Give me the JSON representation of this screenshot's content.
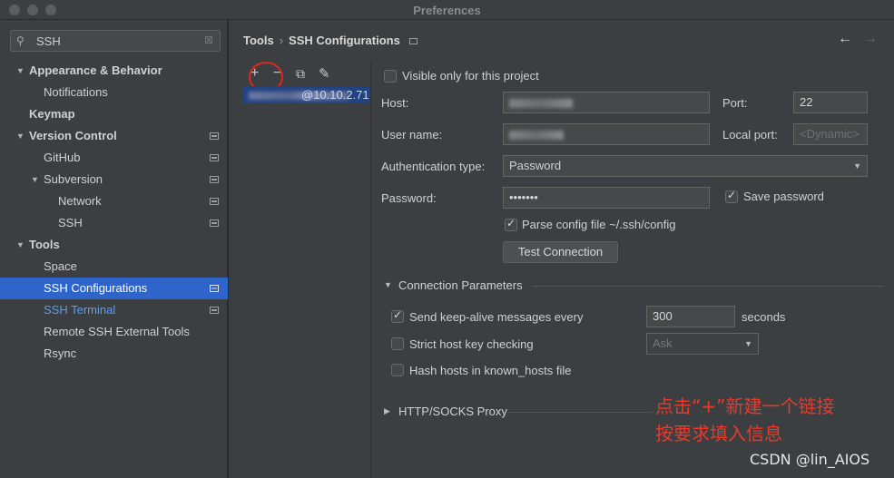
{
  "window": {
    "title": "Preferences"
  },
  "search": {
    "value": "SSH",
    "icon": "search-icon"
  },
  "tree": {
    "appearance": "Appearance & Behavior",
    "notifications": "Notifications",
    "keymap": "Keymap",
    "version_control": "Version Control",
    "github": "GitHub",
    "subversion": "Subversion",
    "network": "Network",
    "ssh": "SSH",
    "tools": "Tools",
    "space": "Space",
    "ssh_configurations": "SSH Configurations",
    "ssh_terminal": "SSH Terminal",
    "remote_ssh_tools": "Remote SSH External Tools",
    "rsync": "Rsync"
  },
  "breadcrumb": {
    "parent": "Tools",
    "current": "SSH Configurations"
  },
  "toolbar": {
    "add": "+",
    "remove": "−",
    "copy": "⧉",
    "edit": "✎"
  },
  "connection": {
    "visible_text": "@10.10.2.71"
  },
  "form": {
    "visible_only": "Visible only for this project",
    "host_label": "Host:",
    "port_label": "Port:",
    "port_value": "22",
    "user_label": "User name:",
    "local_port_label": "Local port:",
    "local_port_placeholder": "<Dynamic>",
    "auth_label": "Authentication type:",
    "auth_value": "Password",
    "password_label": "Password:",
    "password_value": "•••••••",
    "save_password": "Save password",
    "parse_config": "Parse config file ~/.ssh/config",
    "test_connection": "Test Connection"
  },
  "conn_params": {
    "title": "Connection Parameters",
    "keepalive_label": "Send keep-alive messages every",
    "keepalive_value": "300",
    "seconds": "seconds",
    "strict_label": "Strict host key checking",
    "strict_value": "Ask",
    "hash_label": "Hash hosts in known_hosts file"
  },
  "proxy": {
    "title": "HTTP/SOCKS Proxy"
  },
  "annotation": {
    "line1": "点击“+”新建一个链接",
    "line2": "按要求填入信息"
  },
  "watermark": "CSDN @lin_AIOS",
  "colors": {
    "accent": "#2f65ca",
    "annotation": "#e83a2c",
    "link": "#589df6"
  }
}
